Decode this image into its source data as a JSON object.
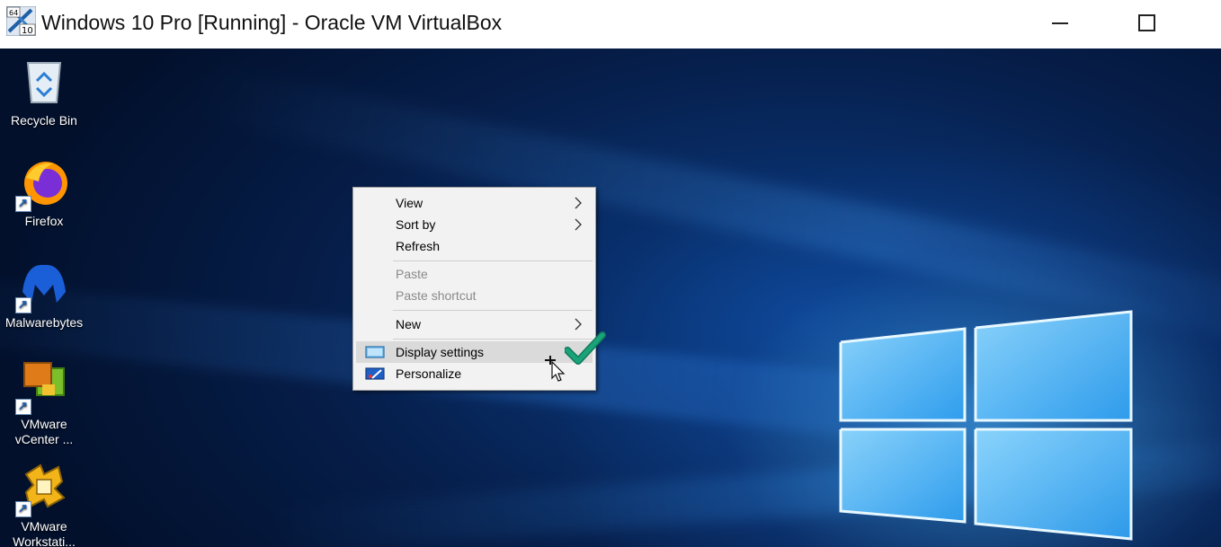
{
  "window": {
    "title": "Windows 10 Pro [Running] - Oracle VM VirtualBox",
    "icon_name": "virtualbox-icon",
    "icon_badge_top": "64",
    "icon_badge_bottom": "10"
  },
  "desktop_icons": [
    {
      "label": "Recycle Bin",
      "icon": "recycle-bin-icon"
    },
    {
      "label": "Firefox",
      "icon": "firefox-icon"
    },
    {
      "label": "Malwarebytes",
      "icon": "malwarebytes-icon"
    },
    {
      "label": "VMware vCenter ...",
      "icon": "vmware-vcenter-icon"
    },
    {
      "label": "VMware Workstati...",
      "icon": "vmware-workstation-icon"
    }
  ],
  "context_menu": {
    "items": [
      {
        "label": "View",
        "submenu": true,
        "enabled": true
      },
      {
        "label": "Sort by",
        "submenu": true,
        "enabled": true
      },
      {
        "label": "Refresh",
        "submenu": false,
        "enabled": true
      },
      {
        "label": "Paste",
        "submenu": false,
        "enabled": false
      },
      {
        "label": "Paste shortcut",
        "submenu": false,
        "enabled": false
      },
      {
        "label": "New",
        "submenu": true,
        "enabled": true
      },
      {
        "label": "Display settings",
        "submenu": false,
        "enabled": true,
        "highlighted": true,
        "icon": "display-icon"
      },
      {
        "label": "Personalize",
        "submenu": false,
        "enabled": true,
        "icon": "personalize-icon"
      }
    ]
  },
  "annotation": {
    "checkmark_color": "#1aa37a"
  },
  "colors": {
    "menu_bg": "#f2f2f2",
    "menu_highlight": "#dadada",
    "desktop_blue": "#0b3f8a"
  }
}
